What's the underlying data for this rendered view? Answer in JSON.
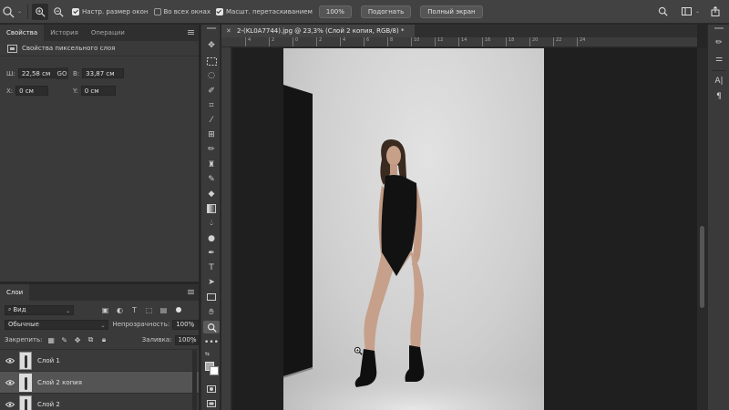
{
  "options_bar": {
    "resize_windows_label": "Настр. размер окон",
    "resize_windows_checked": true,
    "all_windows_label": "Во всех окнах",
    "all_windows_checked": false,
    "scrubby_zoom_label": "Масшт. перетаскиванием",
    "scrubby_zoom_checked": true,
    "zoom_100_label": "100%",
    "fit_label": "Подогнать",
    "fullscreen_label": "Полный экран"
  },
  "properties_panel": {
    "tabs": [
      {
        "label": "Свойства",
        "active": true
      },
      {
        "label": "История",
        "active": false
      },
      {
        "label": "Операции",
        "active": false
      }
    ],
    "section_title": "Свойства пиксельного слоя",
    "width_label": "Ш:",
    "width_value": "22,58 см",
    "link_label": "GO",
    "height_label": "В:",
    "height_value": "33,87 см",
    "x_label": "X:",
    "x_value": "0 см",
    "y_label": "Y:",
    "y_value": "0 см"
  },
  "layers_panel": {
    "tab_label": "Слои",
    "filter_kind": "Вид",
    "blend_mode": "Обычные",
    "opacity_label": "Непрозрачность:",
    "opacity_value": "100%",
    "lock_label": "Закрепить:",
    "fill_label": "Заливка:",
    "fill_value": "100%",
    "layers": [
      {
        "name": "Слой 1",
        "selected": false
      },
      {
        "name": "Слой 2 копия",
        "selected": true
      },
      {
        "name": "Слой 2",
        "selected": false
      }
    ]
  },
  "document": {
    "tab_title": "2-(KL0A7744).jpg @ 23,3% (Слой 2 копия, RGB/8) *",
    "ruler_labels": [
      "4",
      "2",
      "0",
      "2",
      "4",
      "6",
      "8",
      "10",
      "12",
      "14",
      "16",
      "18",
      "20",
      "22",
      "24"
    ]
  },
  "colors": {
    "panel_bg": "#3a3a3a",
    "options_bar_bg": "#424242",
    "pasteboard": "#1f1f1f",
    "selected_layer": "#545454"
  }
}
